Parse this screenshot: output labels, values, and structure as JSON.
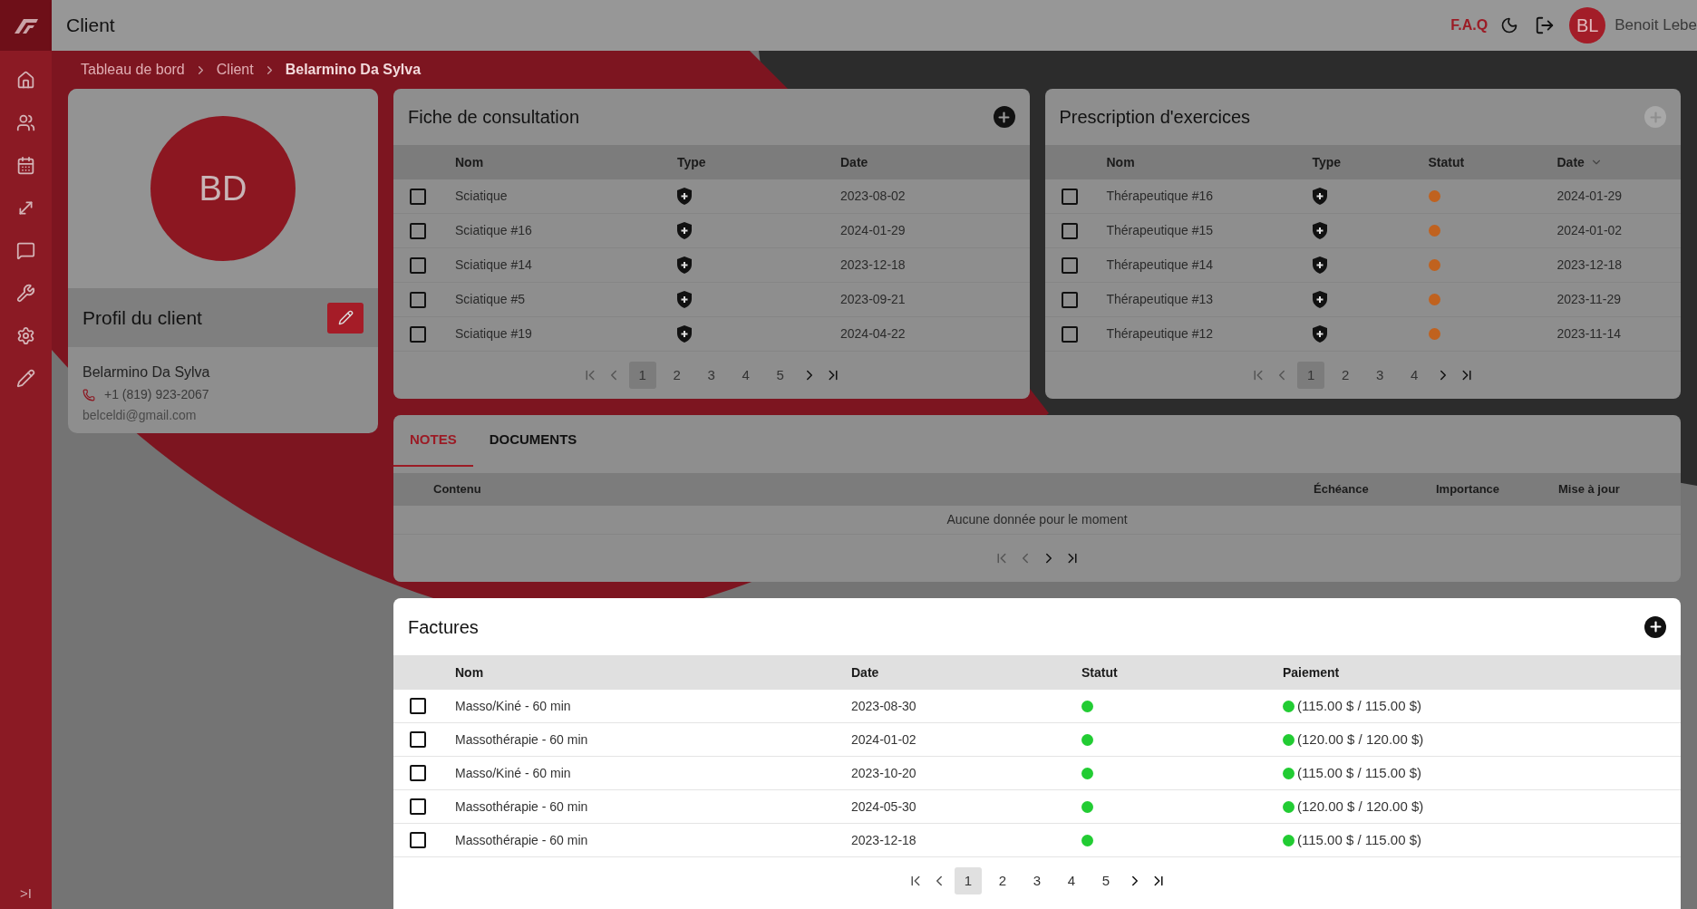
{
  "topbar": {
    "title": "Client",
    "faq": "F.A.Q",
    "user_initials": "BL",
    "user_name": "Benoit Lebe"
  },
  "sidebar": {
    "collapse": ">I"
  },
  "breadcrumb": [
    {
      "label": "Tableau de bord",
      "current": false
    },
    {
      "label": "Client",
      "current": false
    },
    {
      "label": "Belarmino Da Sylva",
      "current": true
    }
  ],
  "profile": {
    "initials": "BD",
    "title": "Profil du client",
    "name": "Belarmino Da Sylva",
    "phone": "+1 (819) 923-2067",
    "email": "belceldi@gmail.com"
  },
  "consultation": {
    "title": "Fiche de consultation",
    "add_disabled": false,
    "columns": [
      "Nom",
      "Type",
      "Date"
    ],
    "rows": [
      {
        "checked": false,
        "name": "Sciatique",
        "date": "2023-08-02"
      },
      {
        "checked": false,
        "name": "Sciatique #16",
        "date": "2024-01-29"
      },
      {
        "checked": false,
        "name": "Sciatique #14",
        "date": "2023-12-18"
      },
      {
        "checked": false,
        "name": "Sciatique #5",
        "date": "2023-09-21"
      },
      {
        "checked": false,
        "name": "Sciatique #19",
        "date": "2024-04-22"
      }
    ],
    "pages": [
      {
        "label": "1",
        "selected": true
      },
      {
        "label": "2",
        "selected": false
      },
      {
        "label": "3",
        "selected": false
      },
      {
        "label": "4",
        "selected": false
      },
      {
        "label": "5",
        "selected": false
      }
    ]
  },
  "prescription": {
    "title": "Prescription d'exercices",
    "add_disabled": true,
    "columns": [
      "Nom",
      "Type",
      "Statut",
      "Date"
    ],
    "rows": [
      {
        "checked": false,
        "name": "Thérapeutique #16",
        "color": "#c0621f",
        "date": "2024-01-29"
      },
      {
        "checked": false,
        "name": "Thérapeutique #15",
        "color": "#c0621f",
        "date": "2024-01-02"
      },
      {
        "checked": false,
        "name": "Thérapeutique #14",
        "color": "#c0621f",
        "date": "2023-12-18"
      },
      {
        "checked": false,
        "name": "Thérapeutique #13",
        "color": "#c0621f",
        "date": "2023-11-29"
      },
      {
        "checked": false,
        "name": "Thérapeutique #12",
        "color": "#c0621f",
        "date": "2023-11-14"
      }
    ],
    "pages": [
      {
        "label": "1",
        "selected": true
      },
      {
        "label": "2",
        "selected": false
      },
      {
        "label": "3",
        "selected": false
      },
      {
        "label": "4",
        "selected": false
      }
    ]
  },
  "notes": {
    "tabs": [
      {
        "label": "NOTES",
        "selected": true
      },
      {
        "label": "DOCUMENTS",
        "selected": false
      }
    ],
    "columns": [
      "Contenu",
      "Échéance",
      "Importance",
      "Mise à jour"
    ],
    "empty": "Aucune donnée pour le moment"
  },
  "factures": {
    "title": "Factures",
    "columns": [
      "Nom",
      "Date",
      "Statut",
      "Paiement"
    ],
    "rows": [
      {
        "checked": false,
        "name": "Masso/Kiné - 60 min",
        "date": "2023-08-30",
        "color": "#22cc33",
        "payment": "(115.00 $ / 115.00 $)"
      },
      {
        "checked": false,
        "name": "Massothérapie - 60 min",
        "date": "2024-01-02",
        "color": "#22cc33",
        "payment": "(120.00 $ / 120.00 $)"
      },
      {
        "checked": false,
        "name": "Masso/Kiné - 60 min",
        "date": "2023-10-20",
        "color": "#22cc33",
        "payment": "(115.00 $ / 115.00 $)"
      },
      {
        "checked": false,
        "name": "Massothérapie - 60 min",
        "date": "2024-05-30",
        "color": "#22cc33",
        "payment": "(120.00 $ / 120.00 $)"
      },
      {
        "checked": false,
        "name": "Massothérapie - 60 min",
        "date": "2023-12-18",
        "color": "#22cc33",
        "payment": "(115.00 $ / 115.00 $)"
      }
    ],
    "pages": [
      {
        "label": "1",
        "selected": true
      },
      {
        "label": "2",
        "selected": false
      },
      {
        "label": "3",
        "selected": false
      },
      {
        "label": "4",
        "selected": false
      },
      {
        "label": "5",
        "selected": false
      }
    ]
  }
}
